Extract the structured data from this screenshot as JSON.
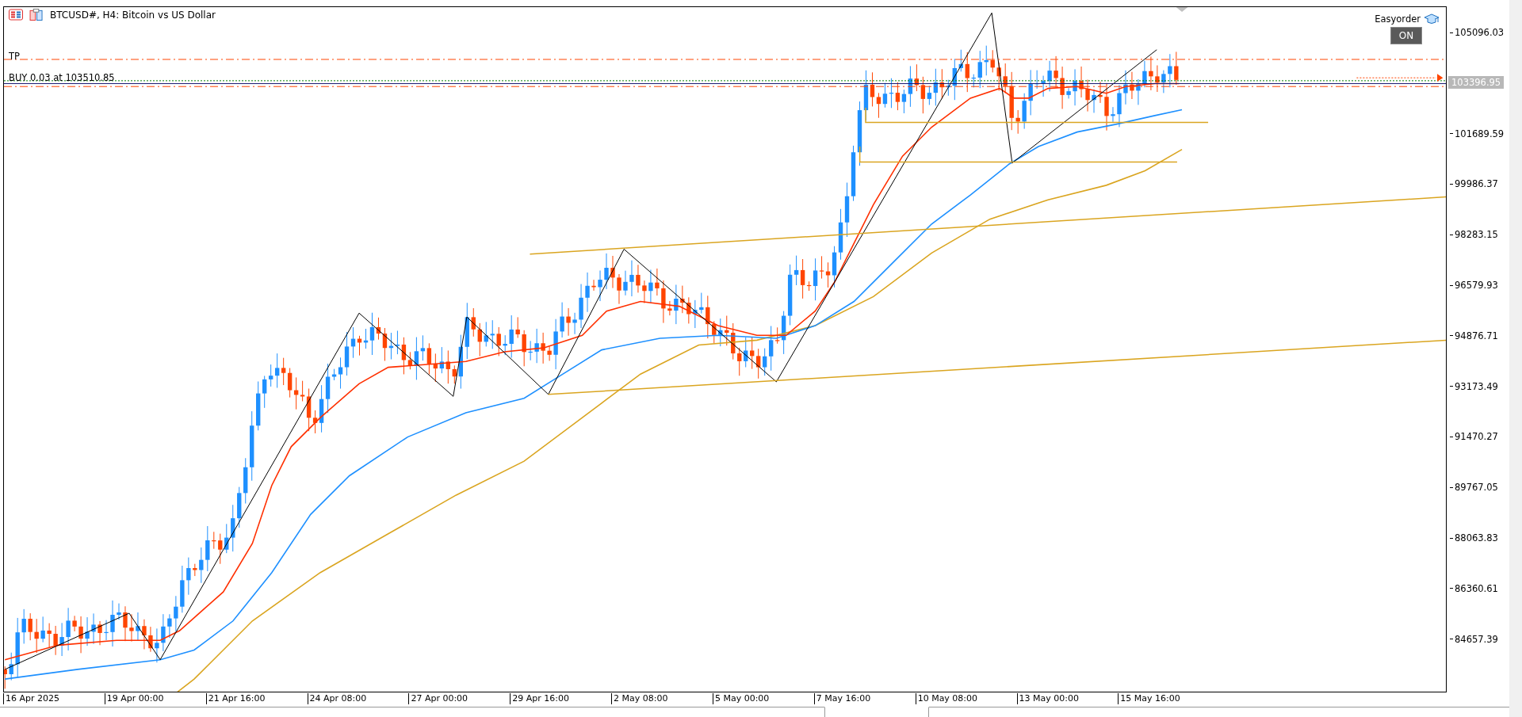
{
  "window": {
    "symbol_title": "BTCUSD#, H4:  Bitcoin vs US Dollar"
  },
  "chart_labels": {
    "take_profit": "TP",
    "order": "BUY 0.03 at 103510.85"
  },
  "expert": {
    "name": "Easyorder",
    "toggle": {
      "label": "ON",
      "on": true
    }
  },
  "price_axis": {
    "labels": [
      "105096.03",
      "101689.59",
      "99986.37",
      "98283.15",
      "96579.93",
      "94876.71",
      "93173.49",
      "91470.27",
      "89767.05",
      "88063.83",
      "86360.61",
      "84657.39"
    ],
    "current_price": "103396.95"
  },
  "time_axis": {
    "labels": [
      "16 Apr 2025",
      "19 Apr 00:00",
      "21 Apr 16:00",
      "24 Apr 08:00",
      "27 Apr 00:00",
      "29 Apr 16:00",
      "2 May 08:00",
      "5 May 00:00",
      "7 May 16:00",
      "10 May 08:00",
      "13 May 00:00",
      "15 May 16:00"
    ]
  }
}
